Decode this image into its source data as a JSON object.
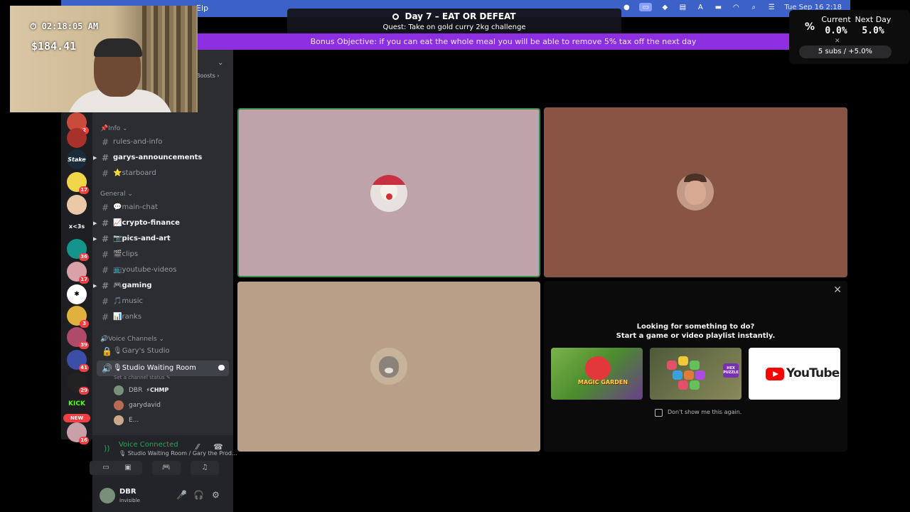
{
  "menubar": {
    "left_text": "Elp",
    "datetime": "Tue Sep 16  2:18"
  },
  "quest": {
    "title": "Day 7 – EAT OR DEFEAT",
    "subtitle": "Quest: Take on gold curry 2kg challenge",
    "bonus": "Bonus Objective: if you can eat the whole meal you will be able to remove 5% tax off the next day"
  },
  "stats": {
    "current_label": "Current",
    "current_value": "0.0%",
    "next_label": "Next Day",
    "next_value": "5.0%",
    "pct_icon": "%",
    "close": "✕",
    "subs": "5 subs / +5.0%"
  },
  "webcam": {
    "clock": "02:18:05 AM",
    "money": "$184.41"
  },
  "channel_panel": {
    "boosts": "Boosts ›",
    "categories": {
      "info": "📌Info ⌄",
      "general": "General ⌄",
      "voice": "🔊Voice Channels ⌄"
    },
    "channels": {
      "rules": "rules-and-info",
      "announcements": "garys-announcements",
      "starboard": "⭐starboard",
      "main_chat": "💬main-chat",
      "crypto": "📈crypto-finance",
      "pics": "📷pics-and-art",
      "clips": "🎬clips",
      "youtube": "📺youtube-videos",
      "gaming": "🎮gaming",
      "music": "🎵music",
      "ranks": "📊ranks",
      "garys_studio": "🎙Gary's Studio",
      "waiting_room": "🎙Studio Waiting Room"
    },
    "waiting_status": "Set a channel status ✎",
    "voice_users": [
      {
        "name": "DBR",
        "tag": "⚡CHMP"
      },
      {
        "name": "garydavid",
        "tag": ""
      },
      {
        "name": "E...",
        "tag": ""
      }
    ]
  },
  "server_rail": {
    "badges": [
      "2",
      "",
      "",
      "17",
      "",
      "",
      "36",
      "17",
      "",
      "3",
      "39",
      "41",
      "29",
      "",
      "16"
    ],
    "labels": {
      "stake": "Stake",
      "x3s": "x<3s",
      "kick": "KICK"
    },
    "new_badge": "NEW"
  },
  "voice_bar": {
    "status": "Voice Connected",
    "room": "🎙 Studio Waiting Room / Gary the Prod..."
  },
  "user_bar": {
    "name": "DBR",
    "status": "Invisible"
  },
  "activity": {
    "line1": "Looking for something to do?",
    "line2": "Start a game or video playlist instantly.",
    "magic_label": "MAGIC GARDEN",
    "hex_label": "HEX PUZZLE",
    "youtube_label": "YouTube",
    "checkbox_label": "Don't show me this again.",
    "close": "✕"
  },
  "colors": {
    "menubar": "#3d62c7",
    "bonus_bar": "#8b2fe0",
    "tile_1": "#bea3aa",
    "tile_2": "#885443",
    "tile_3": "#b99f88",
    "voice_green": "#23a55a"
  }
}
